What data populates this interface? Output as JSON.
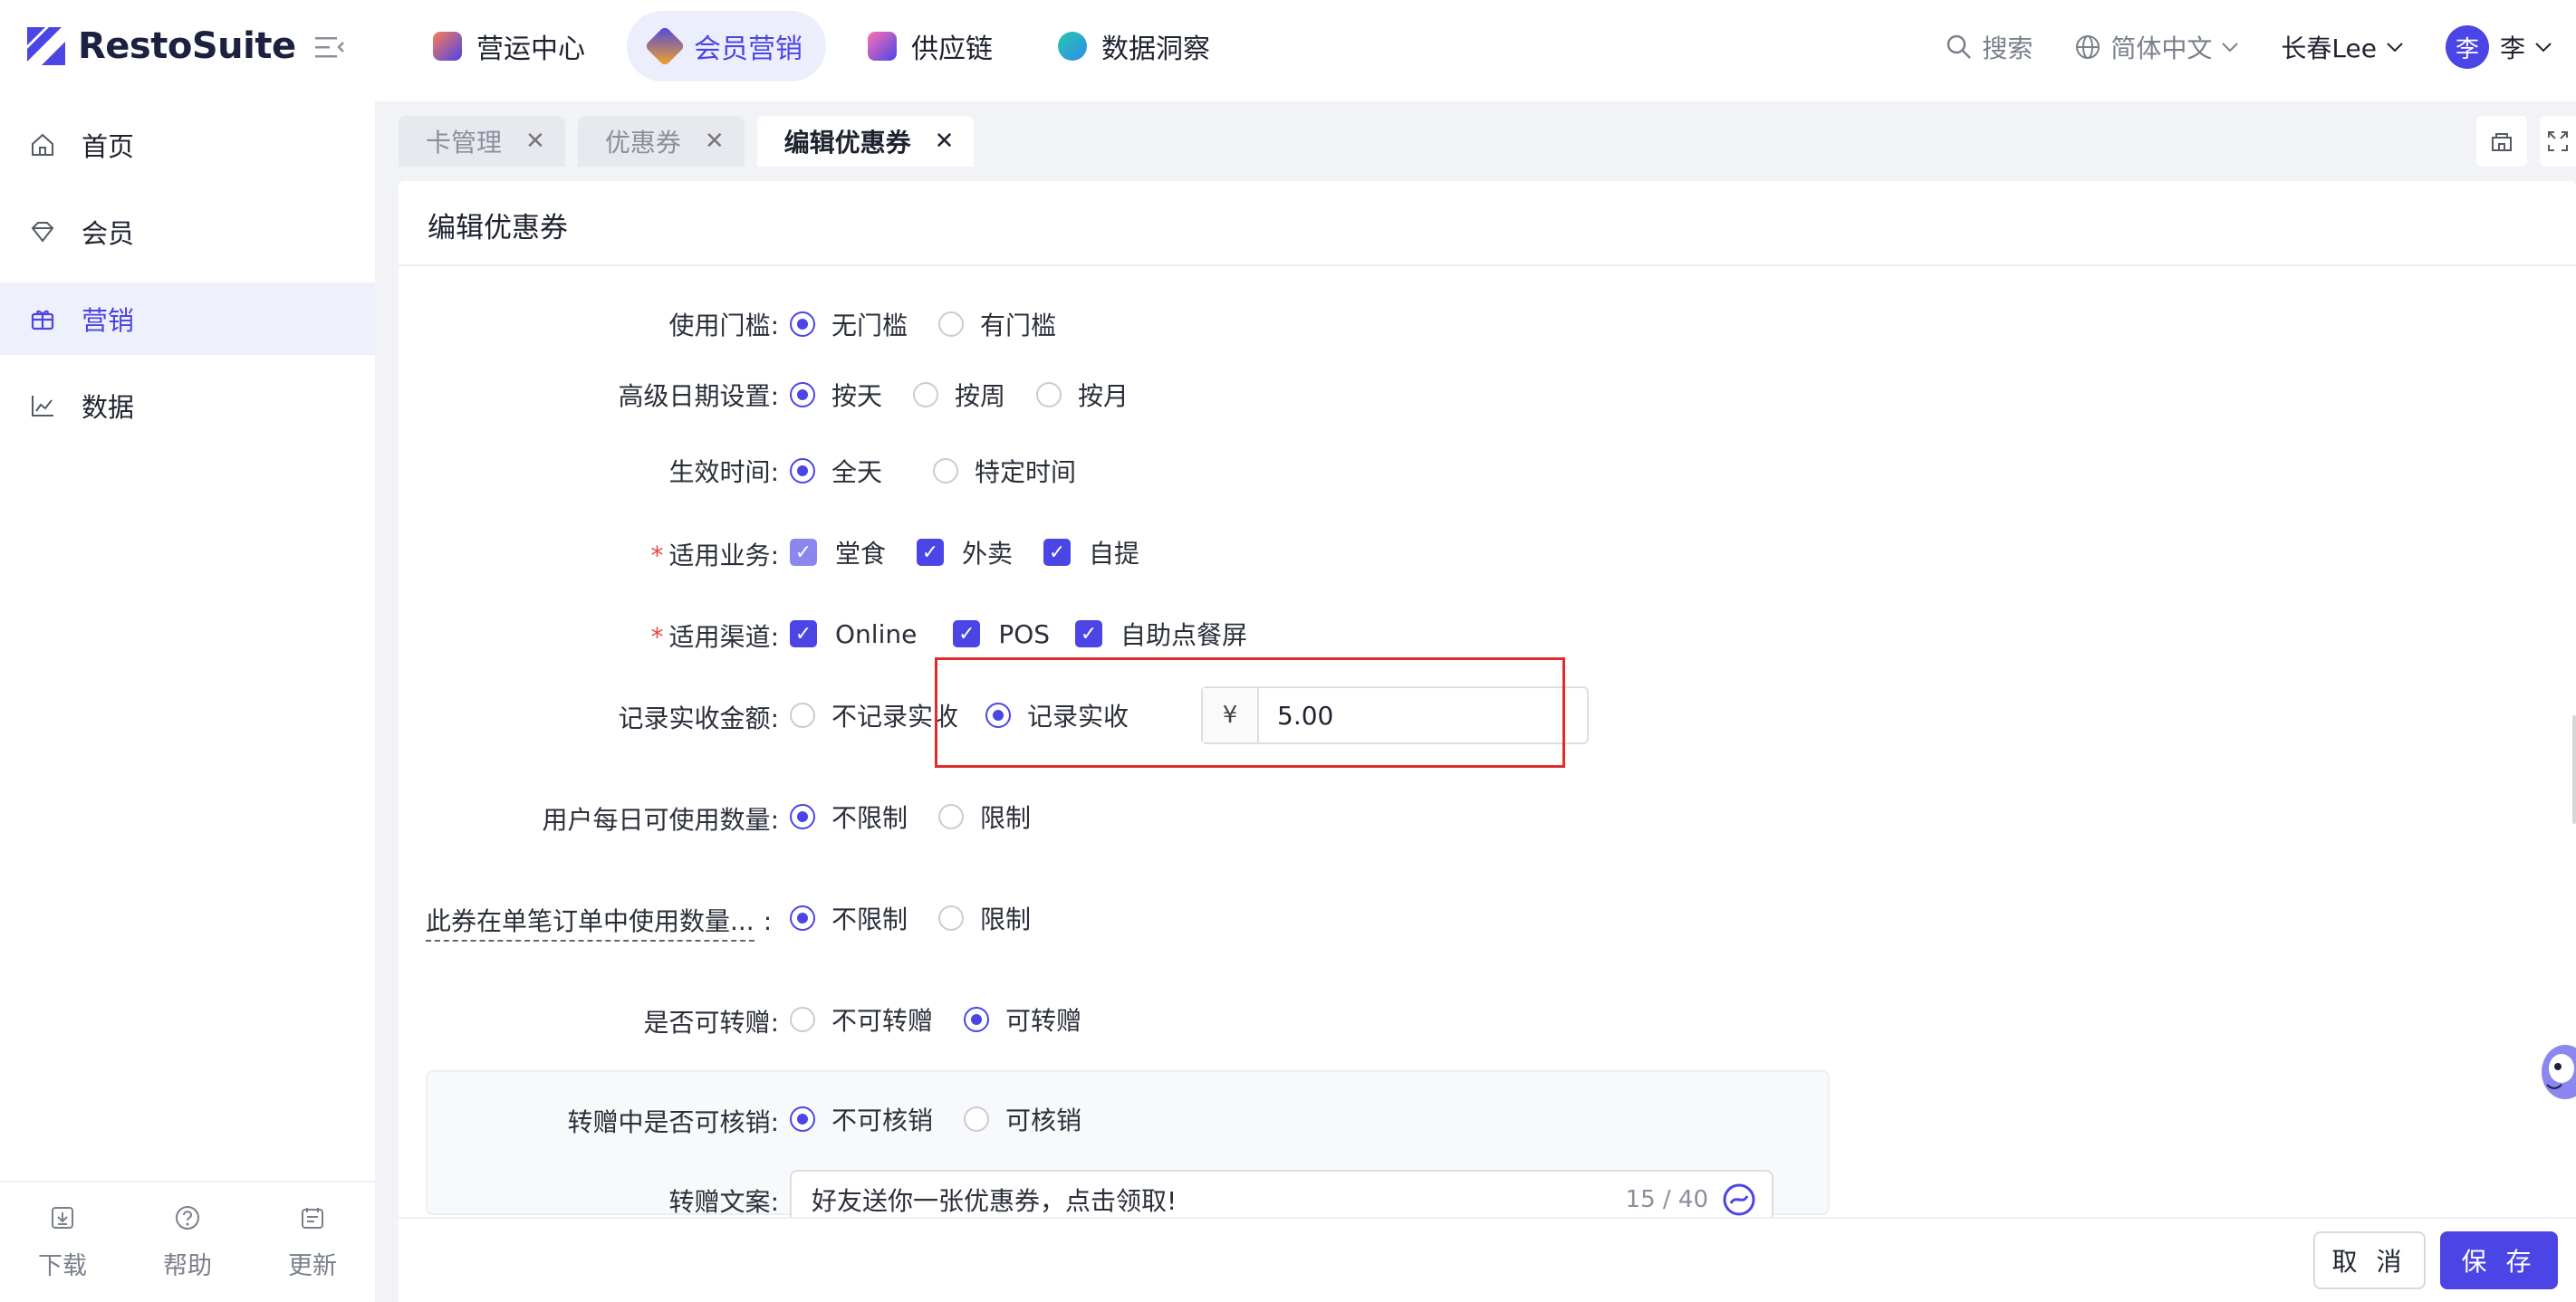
{
  "brand": {
    "name": "RestoSuite"
  },
  "nav": [
    {
      "label": "营运中心",
      "color": "#e8534a"
    },
    {
      "label": "会员营销",
      "color": "#f5a623"
    },
    {
      "label": "供应链",
      "color": "#7b61ff"
    },
    {
      "label": "数据洞察",
      "color": "#2f8cf0"
    }
  ],
  "header": {
    "search": "搜索",
    "language": "简体中文",
    "store": "长春Lee",
    "avatar_char": "李",
    "user": "李"
  },
  "sidebar": {
    "items": [
      {
        "label": "首页"
      },
      {
        "label": "会员"
      },
      {
        "label": "营销"
      },
      {
        "label": "数据"
      }
    ],
    "bottom": {
      "download": "下载",
      "help": "帮助",
      "update": "更新"
    }
  },
  "tabs": [
    {
      "label": "卡管理"
    },
    {
      "label": "优惠券"
    },
    {
      "label": "编辑优惠券"
    }
  ],
  "page": {
    "title": "编辑优惠券"
  },
  "form": {
    "threshold": {
      "label": "使用门槛",
      "options": [
        "无门槛",
        "有门槛"
      ],
      "selected": "无门槛"
    },
    "advanced_date": {
      "label": "高级日期设置",
      "options": [
        "按天",
        "按周",
        "按月"
      ],
      "selected": "按天"
    },
    "effective_time": {
      "label": "生效时间",
      "options": [
        "全天",
        "特定时间"
      ],
      "selected": "全天"
    },
    "business": {
      "label": "适用业务",
      "options": [
        "堂食",
        "外卖",
        "自提"
      ]
    },
    "channel": {
      "label": "适用渠道",
      "options": [
        "Online",
        "POS",
        "自助点餐屏"
      ]
    },
    "record_amount": {
      "label": "记录实收金额",
      "options": [
        "不记录实收",
        "记录实收"
      ],
      "selected": "记录实收",
      "currency": "¥",
      "value": "5.00"
    },
    "daily_limit": {
      "label": "用户每日可使用数量",
      "options": [
        "不限制",
        "限制"
      ],
      "selected": "不限制"
    },
    "order_limit": {
      "label": "此券在单笔订单中使用数量...",
      "options": [
        "不限制",
        "限制"
      ],
      "selected": "不限制"
    },
    "transferable": {
      "label": "是否可转赠",
      "options": [
        "不可转赠",
        "可转赠"
      ],
      "selected": "可转赠"
    },
    "transfer_redeem": {
      "label": "转赠中是否可核销",
      "options": [
        "不可核销",
        "可核销"
      ],
      "selected": "不可核销"
    },
    "transfer_text": {
      "label": "转赠文案",
      "value": "好友送你一张优惠券，点击领取!",
      "counter": "15 / 40"
    }
  },
  "footer": {
    "cancel": "取 消",
    "save": "保 存"
  },
  "colors": {
    "accent": "#4b45e6",
    "highlight": "#e12c2c"
  }
}
